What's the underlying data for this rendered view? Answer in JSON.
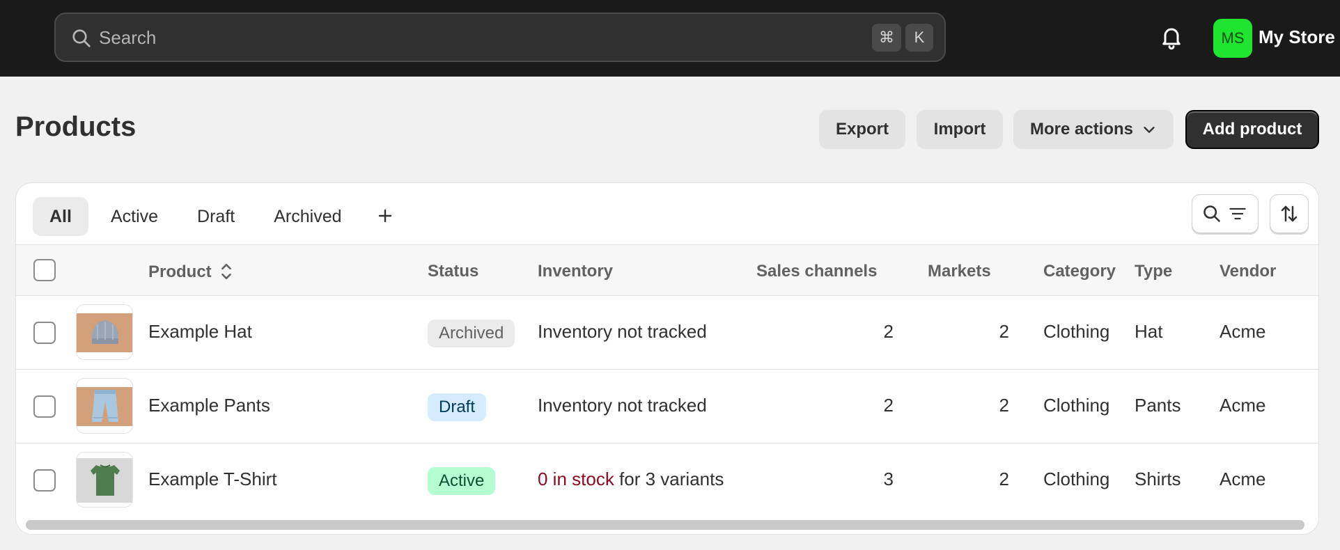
{
  "topbar": {
    "search_placeholder": "Search",
    "shortcut_keys": [
      "⌘",
      "K"
    ],
    "avatar_initials": "MS",
    "store_name": "My Store",
    "avatar_color": "#1fe52f"
  },
  "header": {
    "title": "Products",
    "export_label": "Export",
    "import_label": "Import",
    "more_actions_label": "More actions",
    "add_product_label": "Add product"
  },
  "tabs": [
    {
      "label": "All",
      "selected": true
    },
    {
      "label": "Active",
      "selected": false
    },
    {
      "label": "Draft",
      "selected": false
    },
    {
      "label": "Archived",
      "selected": false
    }
  ],
  "table": {
    "columns": {
      "product": "Product",
      "status": "Status",
      "inventory": "Inventory",
      "sales_channels": "Sales channels",
      "markets": "Markets",
      "category": "Category",
      "type": "Type",
      "vendor": "Vendor"
    },
    "rows": [
      {
        "name": "Example Hat",
        "status": "Archived",
        "inventory": "Inventory not tracked",
        "inventory_alert": "",
        "sales_channels": "2",
        "markets": "2",
        "category": "Clothing",
        "type": "Hat",
        "vendor": "Acme"
      },
      {
        "name": "Example Pants",
        "status": "Draft",
        "inventory": "Inventory not tracked",
        "inventory_alert": "",
        "sales_channels": "2",
        "markets": "2",
        "category": "Clothing",
        "type": "Pants",
        "vendor": "Acme"
      },
      {
        "name": "Example T-Shirt",
        "status": "Active",
        "inventory": " for 3 variants",
        "inventory_alert": "0 in stock",
        "sales_channels": "3",
        "markets": "2",
        "category": "Clothing",
        "type": "Shirts",
        "vendor": "Acme"
      }
    ]
  },
  "icons": {
    "search": "search-icon",
    "bell": "bell-icon",
    "chevron": "chevron-down-icon",
    "filter": "filter-icon",
    "sort": "sort-arrows-icon",
    "plus": "plus-icon"
  }
}
